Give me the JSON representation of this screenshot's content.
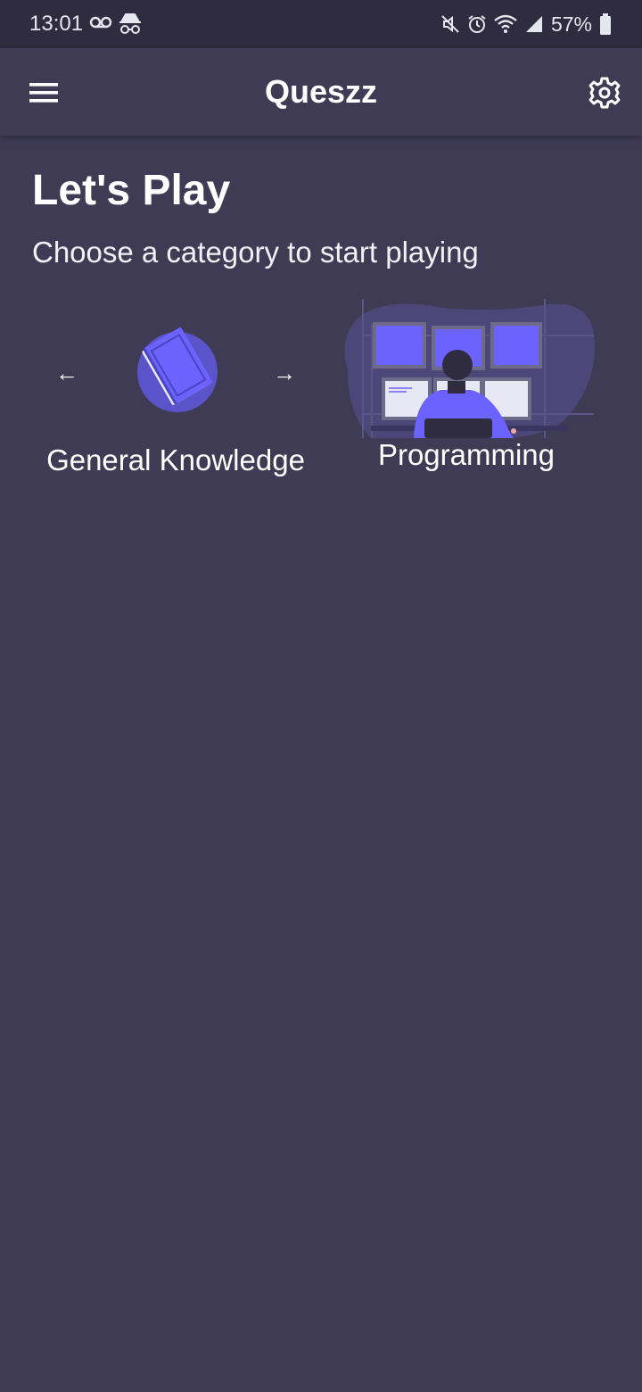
{
  "status_bar": {
    "time": "13:01",
    "battery": "57%",
    "icons": [
      "voicemail-icon",
      "incognito-icon",
      "mute-icon",
      "alarm-icon",
      "wifi-icon",
      "signal-icon",
      "battery-icon"
    ]
  },
  "app_bar": {
    "title": "Queszz",
    "menu_icon": "menu-icon",
    "settings_icon": "gear-icon"
  },
  "main": {
    "heading": "Let's Play",
    "subheading": "Choose a category to start playing",
    "categories": [
      {
        "label": "General Knowledge",
        "icon": "book-icon",
        "arrow_left": "←",
        "arrow_right": "→"
      },
      {
        "label": "Programming",
        "icon": "programmer-illustration"
      }
    ]
  },
  "colors": {
    "background": "#3f3b55",
    "status_bar": "#2f2c40",
    "accent": "#6c63ff",
    "text": "#ffffff"
  }
}
